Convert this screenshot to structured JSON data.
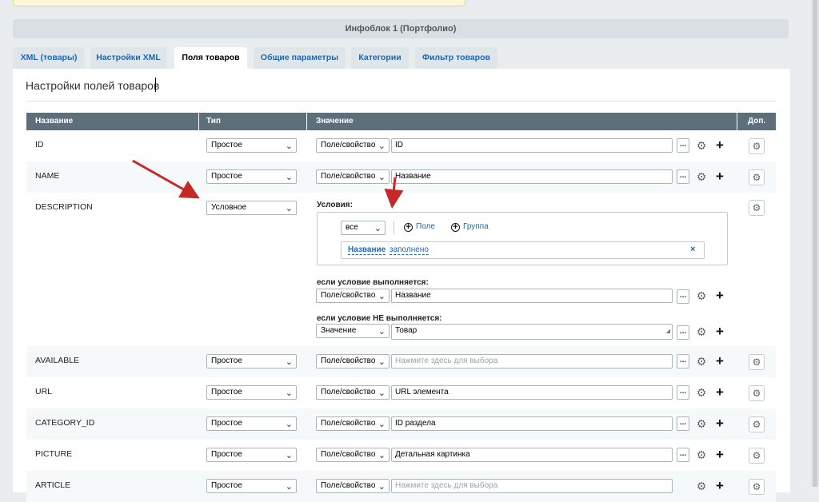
{
  "header": {
    "iblock_title": "Инфоблок 1 (Портфолио)"
  },
  "tabs": [
    {
      "label": "XML (товары)"
    },
    {
      "label": "Настройки XML"
    },
    {
      "label": "Поля товаров"
    },
    {
      "label": "Общие параметры"
    },
    {
      "label": "Категории"
    },
    {
      "label": "Фильтр товаров"
    }
  ],
  "section": {
    "title": "Настройки полей товаров"
  },
  "columns": {
    "name": "Название",
    "type": "Тип",
    "value": "Значение",
    "extra": "Доп."
  },
  "common": {
    "dots": "...",
    "gear_glyph": "⚙",
    "plus_glyph": "+",
    "chevron": "⌄"
  },
  "rows": [
    {
      "name": "ID",
      "type": "Простое",
      "source": "Поле/свойство",
      "value": "ID"
    },
    {
      "name": "NAME",
      "type": "Простое",
      "source": "Поле/свойство",
      "value": "Название"
    },
    {
      "name": "DESCRIPTION",
      "type": "Условное"
    },
    {
      "name": "AVAILABLE",
      "type": "Простое",
      "source": "Поле/свойство",
      "value": "Нажмите здесь для выбора"
    },
    {
      "name": "URL",
      "type": "Простое",
      "source": "Поле/свойство",
      "value": "URL элемента"
    },
    {
      "name": "CATEGORY_ID",
      "type": "Простое",
      "source": "Поле/свойство",
      "value": "ID раздела"
    },
    {
      "name": "PICTURE",
      "type": "Простое",
      "source": "Поле/свойство",
      "value": "Детальная картинка"
    },
    {
      "name": "ARTICLE",
      "type": "Простое",
      "source": "Поле/свойство",
      "value": "Нажмите здесь для выбора"
    }
  ],
  "conditional": {
    "conditions_label": "Условия:",
    "logic": "все",
    "add_field": "Поле",
    "add_group": "Группа",
    "condition_field": "Название",
    "condition_op": "заполнено",
    "remove": "×",
    "if_true_label": "если условие выполняется:",
    "if_true_source": "Поле/свойство",
    "if_true_value": "Название",
    "if_false_label": "если условие НЕ выполняется:",
    "if_false_source": "Значение",
    "if_false_value": "Товар"
  },
  "colors": {
    "header_bg": "#5d6f7b",
    "link": "#2067b0",
    "arrow": "#c62828"
  }
}
